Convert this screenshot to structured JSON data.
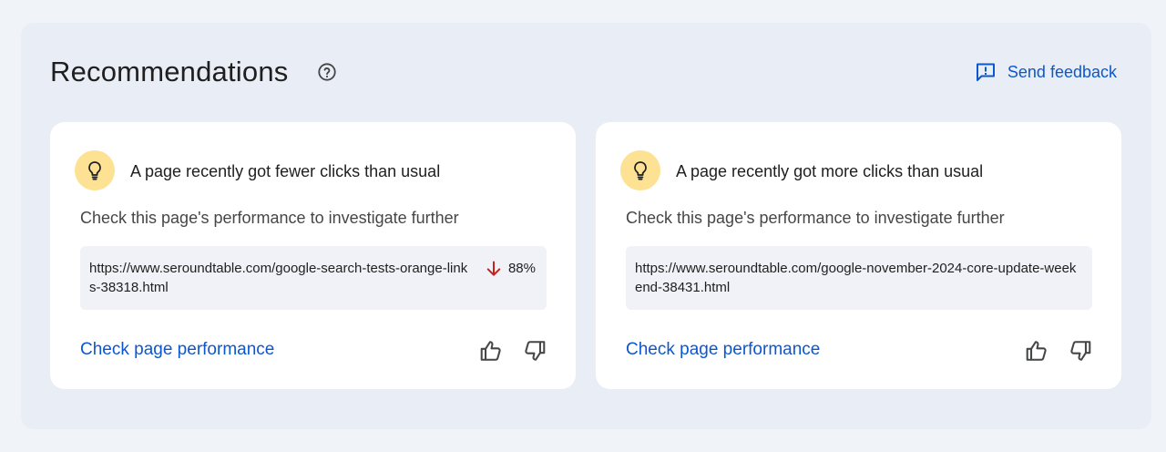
{
  "panel": {
    "title": "Recommendations",
    "help_icon": "help-circle-icon",
    "feedback": {
      "label": "Send feedback",
      "icon": "feedback-icon"
    }
  },
  "cards": [
    {
      "icon": "lightbulb-icon",
      "title": "A page recently got fewer clicks than usual",
      "description": "Check this page's performance to investigate further",
      "url": "https://www.seroundtable.com/google-search-tests-orange-links-38318.html",
      "change": {
        "direction": "down",
        "value": "88%",
        "icon": "arrow-down-icon",
        "color": "#c5221f"
      },
      "link_label": "Check page performance"
    },
    {
      "icon": "lightbulb-icon",
      "title": "A page recently got more clicks than usual",
      "description": "Check this page's performance to investigate further",
      "url": "https://www.seroundtable.com/google-november-2024-core-update-weekend-38431.html",
      "link_label": "Check page performance"
    }
  ],
  "colors": {
    "accent": "#0b57d0",
    "bulb_bg": "#fde293",
    "panel_bg": "#e9eef6",
    "page_bg": "#f0f4f9"
  }
}
